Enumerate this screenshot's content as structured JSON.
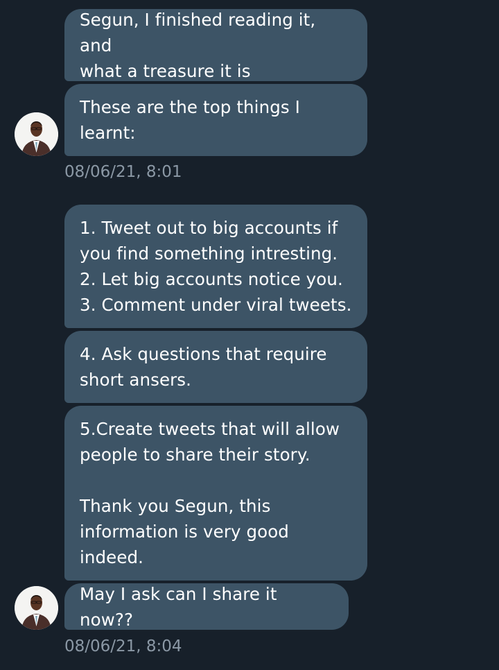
{
  "messages": [
    {
      "text": "Segun, I finished reading it, and\nwhat a treasure it is"
    },
    {
      "text": "These are the top things I\nlearnt:"
    },
    {
      "text": "1. Tweet out to big accounts if\nyou find something intresting.\n2. Let big accounts notice you.\n3. Comment under viral tweets."
    },
    {
      "text": "4. Ask questions that require\nshort ansers."
    },
    {
      "text": "5.Create tweets that will allow\npeople to share their story.\n\nThank you Segun, this\ninformation is very good\nindeed."
    },
    {
      "text": "May I ask can I share it now??"
    }
  ],
  "timestamps": [
    "08/06/21, 8:01",
    "08/06/21, 8:04"
  ],
  "colors": {
    "background": "#17202a",
    "bubble": "#3d5466",
    "text": "#ffffff",
    "timestamp": "#8b98a5"
  },
  "icons": {
    "avatar": "user-avatar-icon"
  }
}
